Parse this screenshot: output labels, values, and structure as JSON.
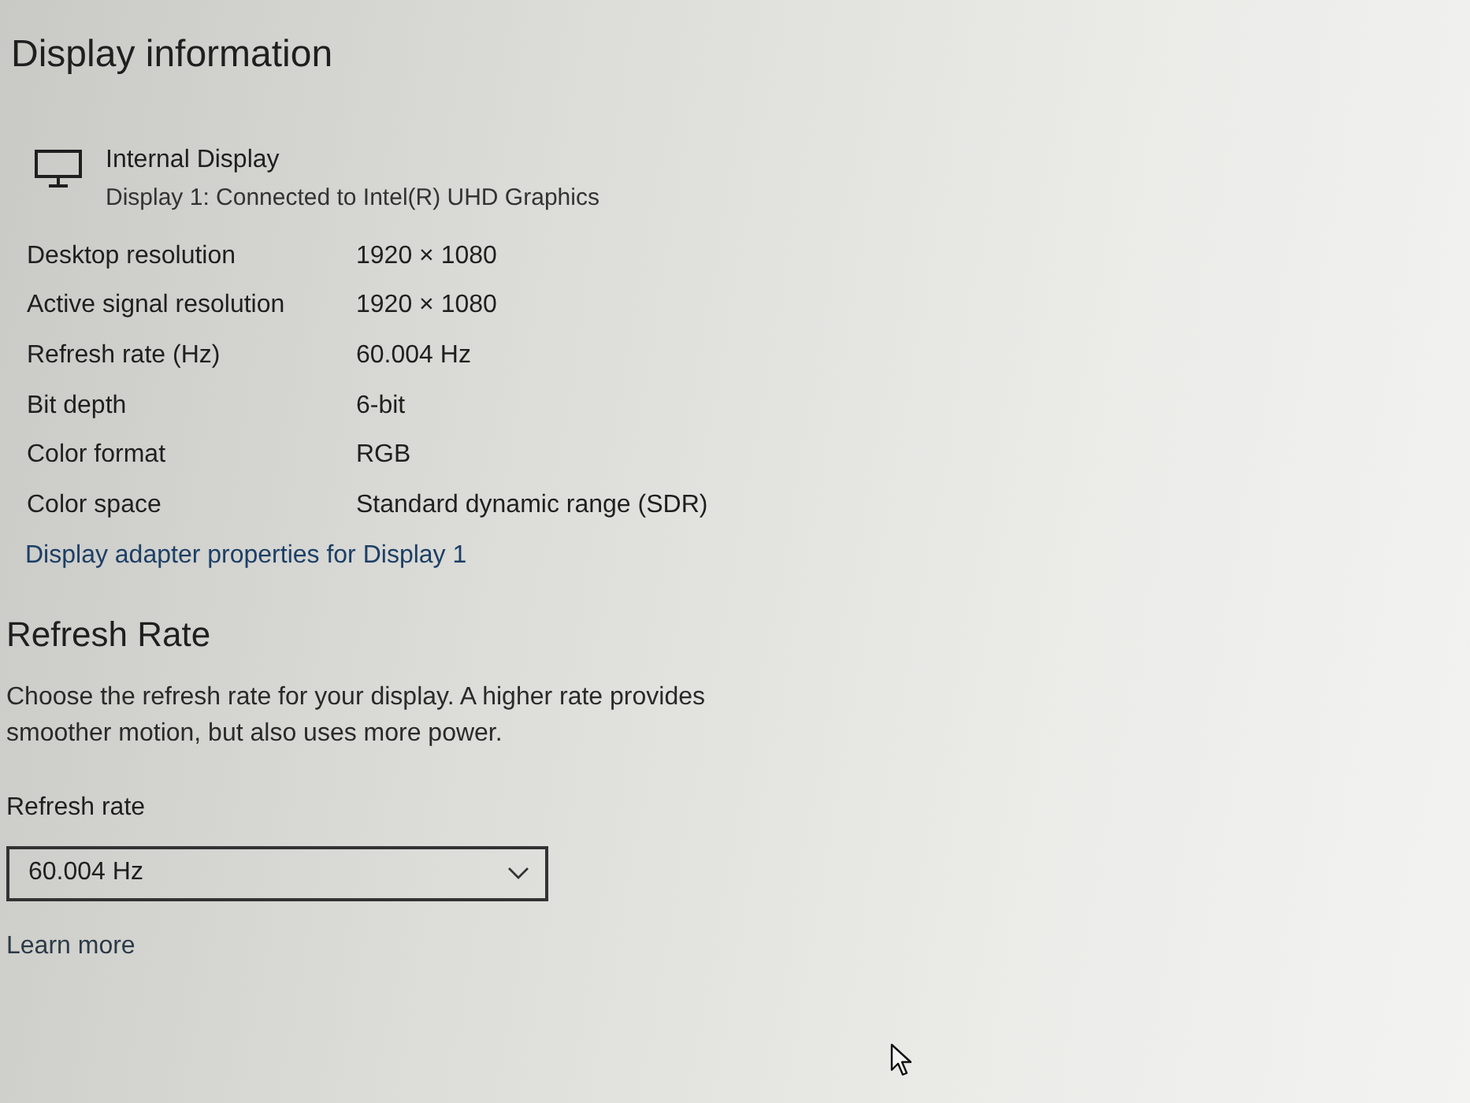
{
  "section_title": "Display information",
  "display": {
    "name": "Internal Display",
    "description": "Display 1: Connected to Intel(R) UHD Graphics"
  },
  "properties": [
    {
      "label": "Desktop resolution",
      "value": "1920 × 1080"
    },
    {
      "label": "Active signal resolution",
      "value": "1920 × 1080"
    },
    {
      "label": "Refresh rate (Hz)",
      "value": "60.004 Hz"
    },
    {
      "label": "Bit depth",
      "value": "6-bit"
    },
    {
      "label": "Color format",
      "value": "RGB"
    },
    {
      "label": "Color space",
      "value": "Standard dynamic range (SDR)"
    }
  ],
  "adapter_link": "Display adapter properties for Display 1",
  "refresh_rate": {
    "title": "Refresh Rate",
    "description": "Choose the refresh rate for your display. A higher rate provides smoother motion, but also uses more power.",
    "field_label": "Refresh rate",
    "value": "60.004 Hz",
    "link": "Learn more"
  }
}
